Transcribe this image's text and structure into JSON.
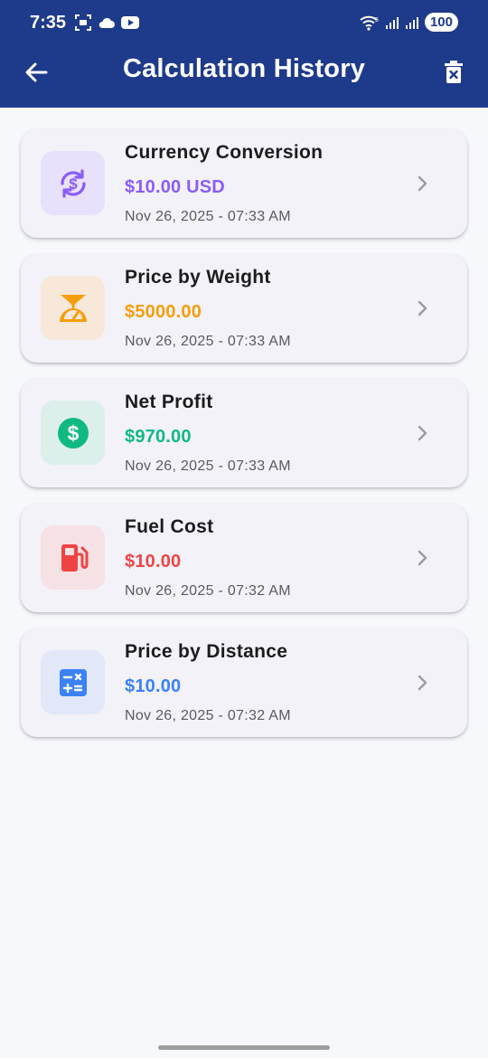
{
  "status_bar": {
    "time": "7:35",
    "battery": "100"
  },
  "app_bar": {
    "title": "Calculation History",
    "back_icon": "arrow-left-icon",
    "delete_icon": "delete-bin-icon",
    "background": "#1e3a8a"
  },
  "history": [
    {
      "title": "Currency Conversion",
      "amount": "$10.00 USD",
      "date": "Nov 26, 2025 - 07:33 AM",
      "icon": "currency-exchange-icon",
      "accent": "#8b5cf6",
      "icon_bg": "#e8e1fb"
    },
    {
      "title": "Price by Weight",
      "amount": "$5000.00",
      "date": "Nov 26, 2025 - 07:33 AM",
      "icon": "scale-icon",
      "accent": "#f59e0b",
      "icon_bg": "#f8e8da"
    },
    {
      "title": "Net Profit",
      "amount": "$970.00",
      "date": "Nov 26, 2025 - 07:33 AM",
      "icon": "dollar-circle-icon",
      "accent": "#10b981",
      "icon_bg": "#dcefeb"
    },
    {
      "title": "Fuel Cost",
      "amount": "$10.00",
      "date": "Nov 26, 2025 - 07:32 AM",
      "icon": "fuel-pump-icon",
      "accent": "#ef4444",
      "icon_bg": "#f6e1e5"
    },
    {
      "title": "Price by Distance",
      "amount": "$10.00",
      "date": "Nov 26, 2025 - 07:32 AM",
      "icon": "calculator-icon",
      "accent": "#3b82f6",
      "icon_bg": "#e2e8f8"
    }
  ]
}
